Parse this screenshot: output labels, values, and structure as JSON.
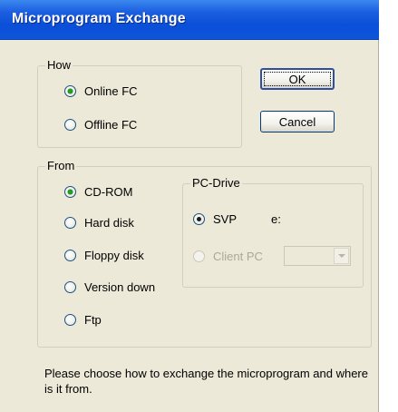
{
  "window": {
    "title": "Microprogram Exchange"
  },
  "how": {
    "legend": "How",
    "options": [
      {
        "label": "Online FC",
        "checked": true
      },
      {
        "label": "Offline FC",
        "checked": false
      }
    ]
  },
  "buttons": {
    "ok": "OK",
    "cancel": "Cancel"
  },
  "from": {
    "legend": "From",
    "options": [
      {
        "label": "CD-ROM",
        "checked": true
      },
      {
        "label": "Hard disk",
        "checked": false
      },
      {
        "label": "Floppy disk",
        "checked": false
      },
      {
        "label": "Version down",
        "checked": false
      },
      {
        "label": "Ftp",
        "checked": false
      }
    ]
  },
  "pc_drive": {
    "legend": "PC-Drive",
    "svp_label": "SVP",
    "svp_checked": true,
    "svp_drive": "e:",
    "client_pc_label": "Client PC",
    "client_pc_enabled": false,
    "client_pc_drive_value": ""
  },
  "message": "Please choose how to exchange the microprogram and where is it from."
}
